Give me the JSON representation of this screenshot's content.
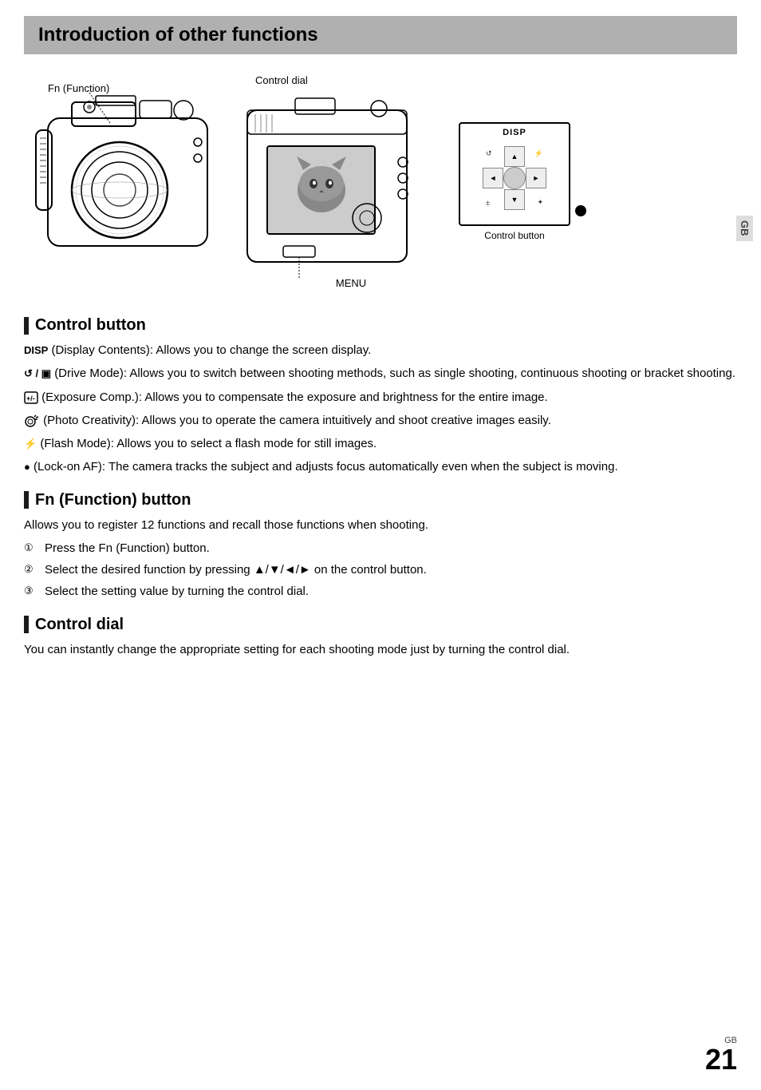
{
  "page": {
    "title": "Introduction of other functions",
    "gb_label": "GB",
    "page_number": "21",
    "page_number_gb": "GB"
  },
  "diagram": {
    "fn_label": "Fn (Function)",
    "control_dial_label": "Control dial",
    "menu_label": "MENU",
    "control_button_label": "Control button",
    "disp_text": "DISP"
  },
  "control_button_section": {
    "title": "Control button",
    "items": [
      {
        "icon": "DISP",
        "text": "(Display Contents): Allows you to change the screen display."
      },
      {
        "icon": "↺ / ▣",
        "text": "(Drive Mode): Allows you to switch between shooting methods, such as single shooting, continuous shooting or bracket shooting."
      },
      {
        "icon": "⬚",
        "text": "(Exposure Comp.): Allows you to compensate the exposure and brightness for the entire image."
      },
      {
        "icon": "📷✦",
        "text": "(Photo Creativity): Allows you to operate the camera intuitively and shoot creative images easily."
      },
      {
        "icon": "⚡",
        "text": "(Flash Mode): Allows you to select a flash mode for still images."
      },
      {
        "icon": "●",
        "text": "(Lock-on AF): The camera tracks the subject and adjusts focus automatically even when the subject is moving."
      }
    ]
  },
  "fn_button_section": {
    "title": "Fn (Function) button",
    "intro": "Allows you to register 12 functions and recall those functions when shooting.",
    "steps": [
      "Press the Fn (Function) button.",
      "Select the desired function by pressing ▲/▼/◄/► on the control button.",
      "Select the setting value by turning the control dial."
    ]
  },
  "control_dial_section": {
    "title": "Control dial",
    "text": "You can instantly change the appropriate setting for each shooting mode just by turning the control dial."
  }
}
